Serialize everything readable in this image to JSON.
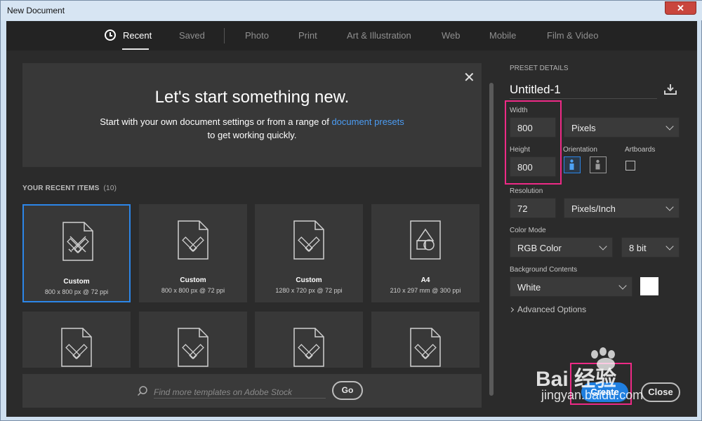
{
  "window": {
    "title": "New Document",
    "close_glyph": "✕"
  },
  "tabs": [
    {
      "label": "Recent",
      "active": true
    },
    {
      "label": "Saved"
    },
    {
      "label": "Photo"
    },
    {
      "label": "Print"
    },
    {
      "label": "Art & Illustration"
    },
    {
      "label": "Web"
    },
    {
      "label": "Mobile"
    },
    {
      "label": "Film & Video"
    }
  ],
  "hero": {
    "title": "Let's start something new.",
    "subtitle_before": "Start with your own document settings or from a range of ",
    "subtitle_link": "document presets",
    "subtitle_after": "to get working quickly.",
    "close_glyph": "✕"
  },
  "recent": {
    "header": "YOUR RECENT ITEMS",
    "count": "(10)",
    "items": [
      {
        "name": "Custom",
        "dims": "800 x 800 px @ 72 ppi",
        "icon": "custom-doc-icon",
        "selected": true
      },
      {
        "name": "Custom",
        "dims": "800 x 800 px @ 72 ppi",
        "icon": "custom-doc-icon"
      },
      {
        "name": "Custom",
        "dims": "1280 x 720 px @ 72 ppi",
        "icon": "custom-doc-icon"
      },
      {
        "name": "A4",
        "dims": "210 x 297 mm @ 300 ppi",
        "icon": "print-doc-icon"
      }
    ]
  },
  "stock": {
    "placeholder": "Find more templates on Adobe Stock",
    "go_label": "Go"
  },
  "preset": {
    "header": "PRESET DETAILS",
    "name": "Untitled-1",
    "width_label": "Width",
    "width_value": "800",
    "width_unit": "Pixels",
    "height_label": "Height",
    "height_value": "800",
    "orientation_label": "Orientation",
    "artboards_label": "Artboards",
    "resolution_label": "Resolution",
    "resolution_value": "72",
    "resolution_unit": "Pixels/Inch",
    "color_mode_label": "Color Mode",
    "color_mode": "RGB Color",
    "bit_depth": "8 bit",
    "background_label": "Background Contents",
    "background": "White",
    "advanced_label": "Advanced Options"
  },
  "actions": {
    "create": "Create",
    "close": "Close"
  },
  "watermark": {
    "logo": "Bai  经验",
    "url": "jingyan.baidu.com"
  },
  "colors": {
    "accent": "#2c86e8",
    "highlight": "#ee2a86",
    "link": "#4b9cf3"
  }
}
